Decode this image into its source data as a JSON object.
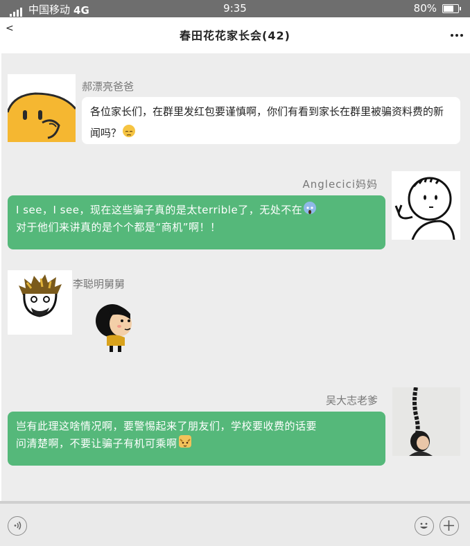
{
  "status_bar": {
    "carrier": "中国移动",
    "network": "4G",
    "time": "9:35",
    "battery_text": "80%",
    "battery_level": 0.8,
    "signal_icon": "signal-icon",
    "battery_icon": "battery-icon"
  },
  "nav": {
    "back_label": "<",
    "title": "春田花花家长会(42)",
    "more_icon": "more-dots-icon"
  },
  "messages": [
    {
      "sender": "郝漂亮爸爸",
      "side": "left",
      "text": "各位家长们，在群里发红包要谨慎啊，你们有看到家长在群里被骗资料费的新闻吗？",
      "emoji": "pensive-face-emoji"
    },
    {
      "sender": "Anglecici妈妈",
      "side": "right",
      "text": "I see，I see，现在这些骗子真的是太terrible了，无处不在",
      "text2": "对于他们来讲真的是个个都是“商机”啊！！",
      "emoji": "screaming-face-emoji"
    },
    {
      "sender": "李聪明舅舅",
      "side": "left",
      "sticker": "cartoon-kid-sticker"
    },
    {
      "sender": "吴大志老爹",
      "side": "right",
      "text": "岂有此理这啥情况啊，要警惕起来了朋友们，学校要收费的话要",
      "text2": "问清楚啊，不要让骗子有机可乘啊",
      "emoji": "cat-face-emoji"
    }
  ],
  "input_bar": {
    "voice_icon": "voice-icon",
    "emoji_icon": "smiley-icon",
    "plus_icon": "plus-icon"
  },
  "colors": {
    "status_bar_bg": "#6e6e6e",
    "chat_bg": "#ededed",
    "green_bubble": "#55b87a",
    "white_bubble": "#ffffff"
  }
}
